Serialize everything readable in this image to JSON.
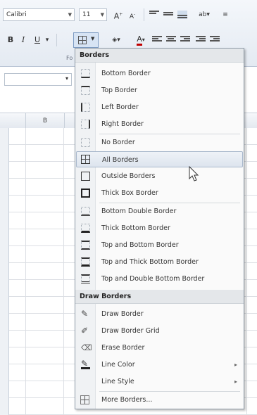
{
  "ribbon": {
    "font_name": "Calibri",
    "font_size": "11",
    "grow_font": "A",
    "shrink_font": "A",
    "bold": "B",
    "italic": "I",
    "underline": "U",
    "font_color_letter": "A",
    "font_group_label": "Fo"
  },
  "column_b": "B",
  "menu": {
    "sections": [
      {
        "header": "Borders"
      },
      {
        "header": "Draw Borders"
      }
    ],
    "border_items": [
      {
        "label": "Bottom Border",
        "icon": "bottom-border-icon"
      },
      {
        "label": "Top Border",
        "icon": "top-border-icon"
      },
      {
        "label": "Left Border",
        "icon": "left-border-icon"
      },
      {
        "label": "Right Border",
        "icon": "right-border-icon"
      },
      {
        "label": "No Border",
        "icon": "no-border-icon"
      },
      {
        "label": "All Borders",
        "icon": "all-borders-icon"
      },
      {
        "label": "Outside Borders",
        "icon": "outside-borders-icon"
      },
      {
        "label": "Thick Box Border",
        "icon": "thick-box-border-icon"
      },
      {
        "label": "Bottom Double Border",
        "icon": "bottom-double-border-icon"
      },
      {
        "label": "Thick Bottom Border",
        "icon": "thick-bottom-border-icon"
      },
      {
        "label": "Top and Bottom Border",
        "icon": "top-and-bottom-border-icon"
      },
      {
        "label": "Top and Thick Bottom Border",
        "icon": "top-and-thick-bottom-border-icon"
      },
      {
        "label": "Top and Double Bottom Border",
        "icon": "top-and-double-bottom-border-icon"
      }
    ],
    "draw_items": [
      {
        "label": "Draw Border",
        "icon": "draw-border-pencil-icon"
      },
      {
        "label": "Draw Border Grid",
        "icon": "draw-border-grid-icon"
      },
      {
        "label": "Erase Border",
        "icon": "eraser-icon"
      },
      {
        "label": "Line Color",
        "icon": "line-color-pencil-icon",
        "submenu": "▸"
      },
      {
        "label": "Line Style",
        "icon": "",
        "submenu": "▸"
      }
    ],
    "more_item": {
      "label": "More Borders...",
      "icon": "more-borders-icon"
    },
    "highlighted": "All Borders"
  },
  "colors": {
    "highlight": "#dde4ee",
    "menu_header": "#e4e7ea",
    "ribbon": "#e4eaf2"
  }
}
